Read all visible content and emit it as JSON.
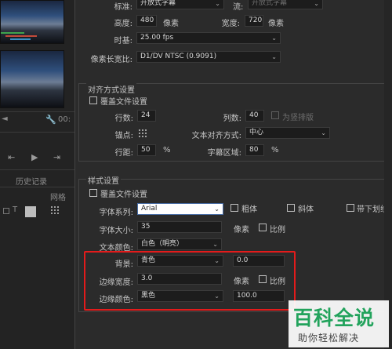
{
  "left_panel": {
    "timecode": "00:",
    "history_tab": "历史记录",
    "grid_label": "网格"
  },
  "top": {
    "standard_label": "标准:",
    "standard_value": "开放式字幕",
    "stream_label": "流:",
    "stream_value": "开放式字幕",
    "height_label": "高度:",
    "height_value": "480",
    "height_unit": "像素",
    "width_label": "宽度:",
    "width_value": "720",
    "width_unit": "像素",
    "timebase_label": "时基:",
    "timebase_value": "25.00 fps",
    "par_label": "像素长宽比:",
    "par_value": "D1/DV NTSC (0.9091)"
  },
  "alignment": {
    "title": "对齐方式设置",
    "override_label": "覆盖文件设置",
    "rows_label": "行数:",
    "rows_value": "24",
    "cols_label": "列数:",
    "cols_value": "40",
    "vertical_label": "为竖排版",
    "anchor_label": "锚点:",
    "text_align_label": "文本对齐方式:",
    "text_align_value": "中心",
    "line_spacing_label": "行距:",
    "line_spacing_value": "50",
    "line_spacing_unit": "%",
    "subtitle_area_label": "字幕区域:",
    "subtitle_area_value": "80",
    "subtitle_area_unit": "%"
  },
  "style": {
    "title": "样式设置",
    "override_label": "覆盖文件设置",
    "font_family_label": "字体系列:",
    "font_family_value": "Arial",
    "bold_label": "粗体",
    "italic_label": "斜体",
    "underline_label": "带下划线",
    "font_size_label": "字体大小:",
    "font_size_value": "35",
    "font_size_unit": "像素",
    "font_size_ratio_label": "比例",
    "text_color_label": "文本颜色:",
    "text_color_value": "白色（明亮）",
    "background_label": "背景:",
    "background_value": "青色",
    "background_opacity": "0.0",
    "edge_width_label": "边缘宽度:",
    "edge_width_value": "3.0",
    "edge_width_unit": "像素",
    "edge_width_ratio_label": "比例",
    "edge_color_label": "边缘颜色:",
    "edge_color_value": "黑色",
    "edge_color_opacity": "100.0"
  },
  "watermark": {
    "brand": "百科全说",
    "slogan": "助你轻松解决"
  },
  "colors": {
    "highlight": "#e31b1b",
    "watermark_green": "#22a35c",
    "active_dropdown": "#ffffff"
  }
}
